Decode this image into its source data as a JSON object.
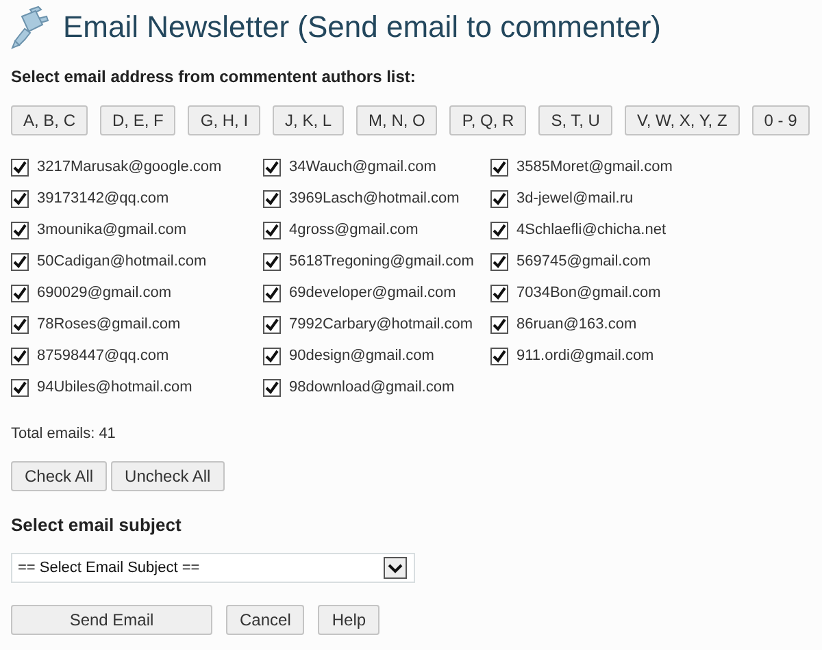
{
  "title": "Email Newsletter (Send email to commenter)",
  "authors_heading": "Select email address from commentent authors list:",
  "letter_buttons": [
    "A, B, C",
    "D, E, F",
    "G, H, I",
    "J, K, L",
    "M, N, O",
    "P, Q, R",
    "S, T, U",
    "V, W, X, Y, Z",
    "0 - 9"
  ],
  "emails": [
    {
      "address": "3217Marusak@google.com",
      "checked": true
    },
    {
      "address": "34Wauch@gmail.com",
      "checked": true
    },
    {
      "address": "3585Moret@gmail.com",
      "checked": true
    },
    {
      "address": "39173142@qq.com",
      "checked": true
    },
    {
      "address": "3969Lasch@hotmail.com",
      "checked": true
    },
    {
      "address": "3d-jewel@mail.ru",
      "checked": true
    },
    {
      "address": "3mounika@gmail.com",
      "checked": true
    },
    {
      "address": "4gross@gmail.com",
      "checked": true
    },
    {
      "address": "4Schlaefli@chicha.net",
      "checked": true
    },
    {
      "address": "50Cadigan@hotmail.com",
      "checked": true
    },
    {
      "address": "5618Tregoning@gmail.com",
      "checked": true
    },
    {
      "address": "569745@gmail.com",
      "checked": true
    },
    {
      "address": "690029@gmail.com",
      "checked": true
    },
    {
      "address": "69developer@gmail.com",
      "checked": true
    },
    {
      "address": "7034Bon@gmail.com",
      "checked": true
    },
    {
      "address": "78Roses@gmail.com",
      "checked": true
    },
    {
      "address": "7992Carbary@hotmail.com",
      "checked": true
    },
    {
      "address": "86ruan@163.com",
      "checked": true
    },
    {
      "address": "87598447@qq.com",
      "checked": true
    },
    {
      "address": "90design@gmail.com",
      "checked": true
    },
    {
      "address": "911.ordi@gmail.com",
      "checked": true
    },
    {
      "address": "94Ubiles@hotmail.com",
      "checked": true
    },
    {
      "address": "98download@gmail.com",
      "checked": true
    }
  ],
  "total": "Total emails: 41",
  "check_buttons": [
    "Check All",
    "Uncheck All"
  ],
  "subject_heading": "Select email subject",
  "subject_select": {
    "value": "== Select Email Subject =="
  },
  "actions": [
    "Send Email",
    "Cancel",
    "Help"
  ]
}
